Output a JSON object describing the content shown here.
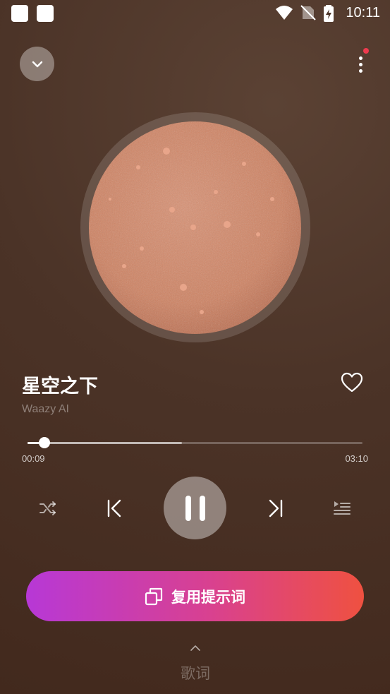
{
  "status_bar": {
    "time": "10:11"
  },
  "song": {
    "title": "星空之下",
    "artist": "Waazy AI"
  },
  "progress": {
    "current": "00:09",
    "total": "03:10",
    "played_fraction": 0.05,
    "buffered_fraction": 0.46
  },
  "actions": {
    "reuse_prompt_label": "复用提示词",
    "lyrics_label": "歌词"
  },
  "colors": {
    "accent_start": "#b738d6",
    "accent_end": "#ef5140",
    "notification_dot": "#ef3b4f"
  }
}
